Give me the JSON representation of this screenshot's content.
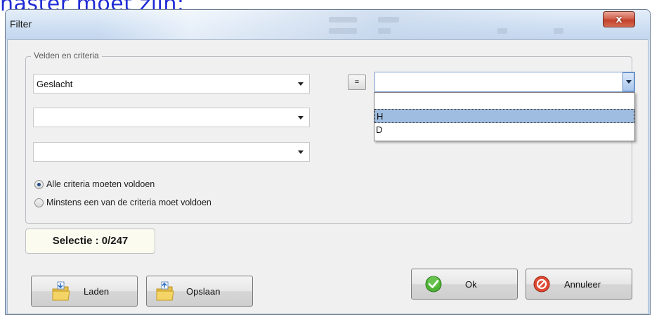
{
  "background": {
    "caption": "naster moet zijn;"
  },
  "window": {
    "title": "Filter",
    "close_label": "x"
  },
  "group": {
    "legend": "Velden en criteria",
    "field1_value": "Geslacht",
    "field2_value": "",
    "field3_value": "",
    "operator_label": "=",
    "value_combo_value": "",
    "dropdown_options": [
      "",
      "H",
      "D"
    ],
    "dropdown_selected": "H"
  },
  "radios": [
    {
      "label": "Alle criteria moeten voldoen",
      "checked": true
    },
    {
      "label": "Minstens een van de criteria moet voldoen",
      "checked": false
    }
  ],
  "selectie": "Selectie : 0/247",
  "buttons": {
    "laden": "Laden",
    "opslaan": "Opslaan",
    "ok": "Ok",
    "annuleer": "Annuleer"
  },
  "colors": {
    "accent_blue": "#1f2bd6",
    "selection": "#9fbde0",
    "ok_green": "#3a9a2a",
    "cancel_red": "#d23a25"
  }
}
